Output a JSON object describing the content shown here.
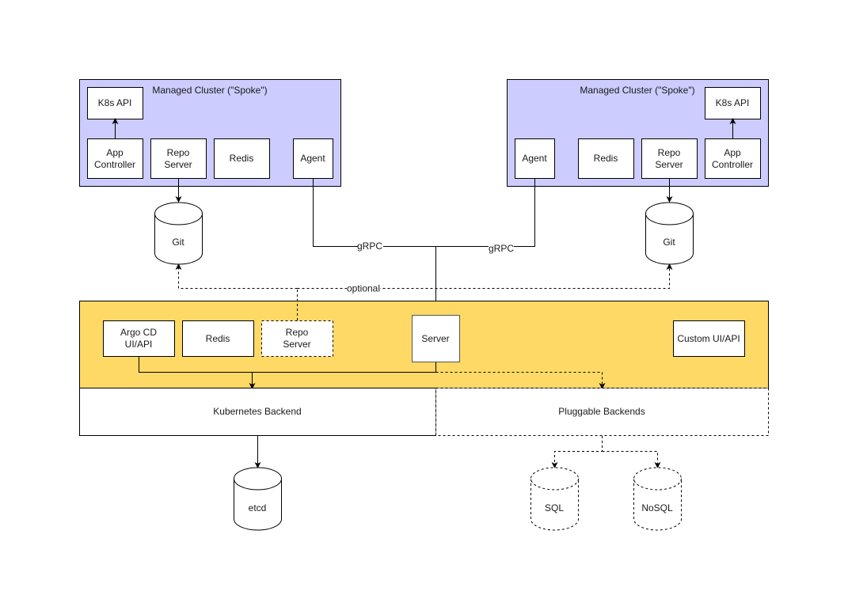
{
  "colors": {
    "spoke_fill": "#ccccff",
    "hub_fill": "#ffd966",
    "box_fill": "#ffffff",
    "stroke": "#000000"
  },
  "spoke_left": {
    "title": "Managed Cluster (\"Spoke\")",
    "k8s_api": "K8s API",
    "app_controller": [
      "App",
      "Controller"
    ],
    "repo_server": [
      "Repo",
      "Server"
    ],
    "redis": "Redis",
    "agent": "Agent",
    "git": "Git"
  },
  "spoke_right": {
    "title": "Managed Cluster (\"Spoke\")",
    "k8s_api": "K8s API",
    "app_controller": [
      "App",
      "Controller"
    ],
    "repo_server": [
      "Repo",
      "Server"
    ],
    "redis": "Redis",
    "agent": "Agent",
    "git": "Git"
  },
  "connections": {
    "grpc_left": "gRPC",
    "grpc_right": "gRPC",
    "optional": "optional"
  },
  "hub": {
    "argocd_ui_api": [
      "Argo CD",
      "UI/API"
    ],
    "redis": "Redis",
    "repo_server": [
      "Repo",
      "Server"
    ],
    "server": "Server",
    "custom_ui_api": "Custom UI/API"
  },
  "backends": {
    "kubernetes": "Kubernetes Backend",
    "pluggable": "Pluggable Backends"
  },
  "stores": {
    "etcd": "etcd",
    "sql": "SQL",
    "nosql": "NoSQL"
  }
}
